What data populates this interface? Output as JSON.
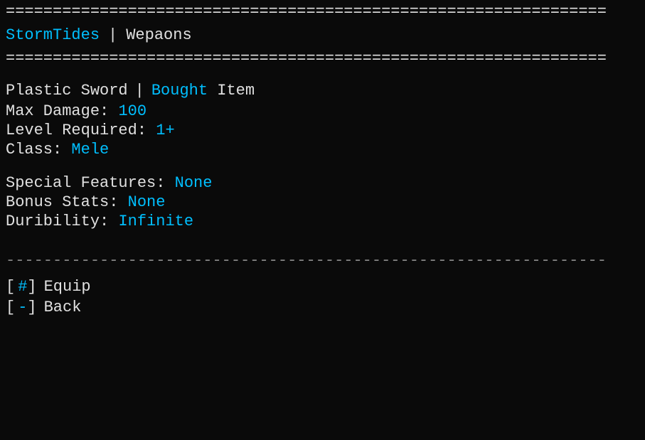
{
  "header": {
    "top_border": "================================================================",
    "brand": "StormTides",
    "separator": "|",
    "section": "Wepaons",
    "second_border": "================================================================"
  },
  "item": {
    "name": "Plastic Sword",
    "pipe": "|",
    "status_label": "Bought",
    "status_suffix": "Item",
    "max_damage_label": "Max Damage:",
    "max_damage_value": "100",
    "level_required_label": "Level Required:",
    "level_required_value": "1+",
    "class_label": "Class:",
    "class_value": "Mele",
    "special_features_label": "Special Features:",
    "special_features_value": "None",
    "bonus_stats_label": "Bonus Stats:",
    "bonus_stats_value": "None",
    "duribility_label": "Duribility:",
    "duribility_value": "Infinite"
  },
  "divider": "----------------------------------------------------------------",
  "actions": [
    {
      "key": "#",
      "label": "Equip"
    },
    {
      "key": "-",
      "label": "Back"
    }
  ]
}
